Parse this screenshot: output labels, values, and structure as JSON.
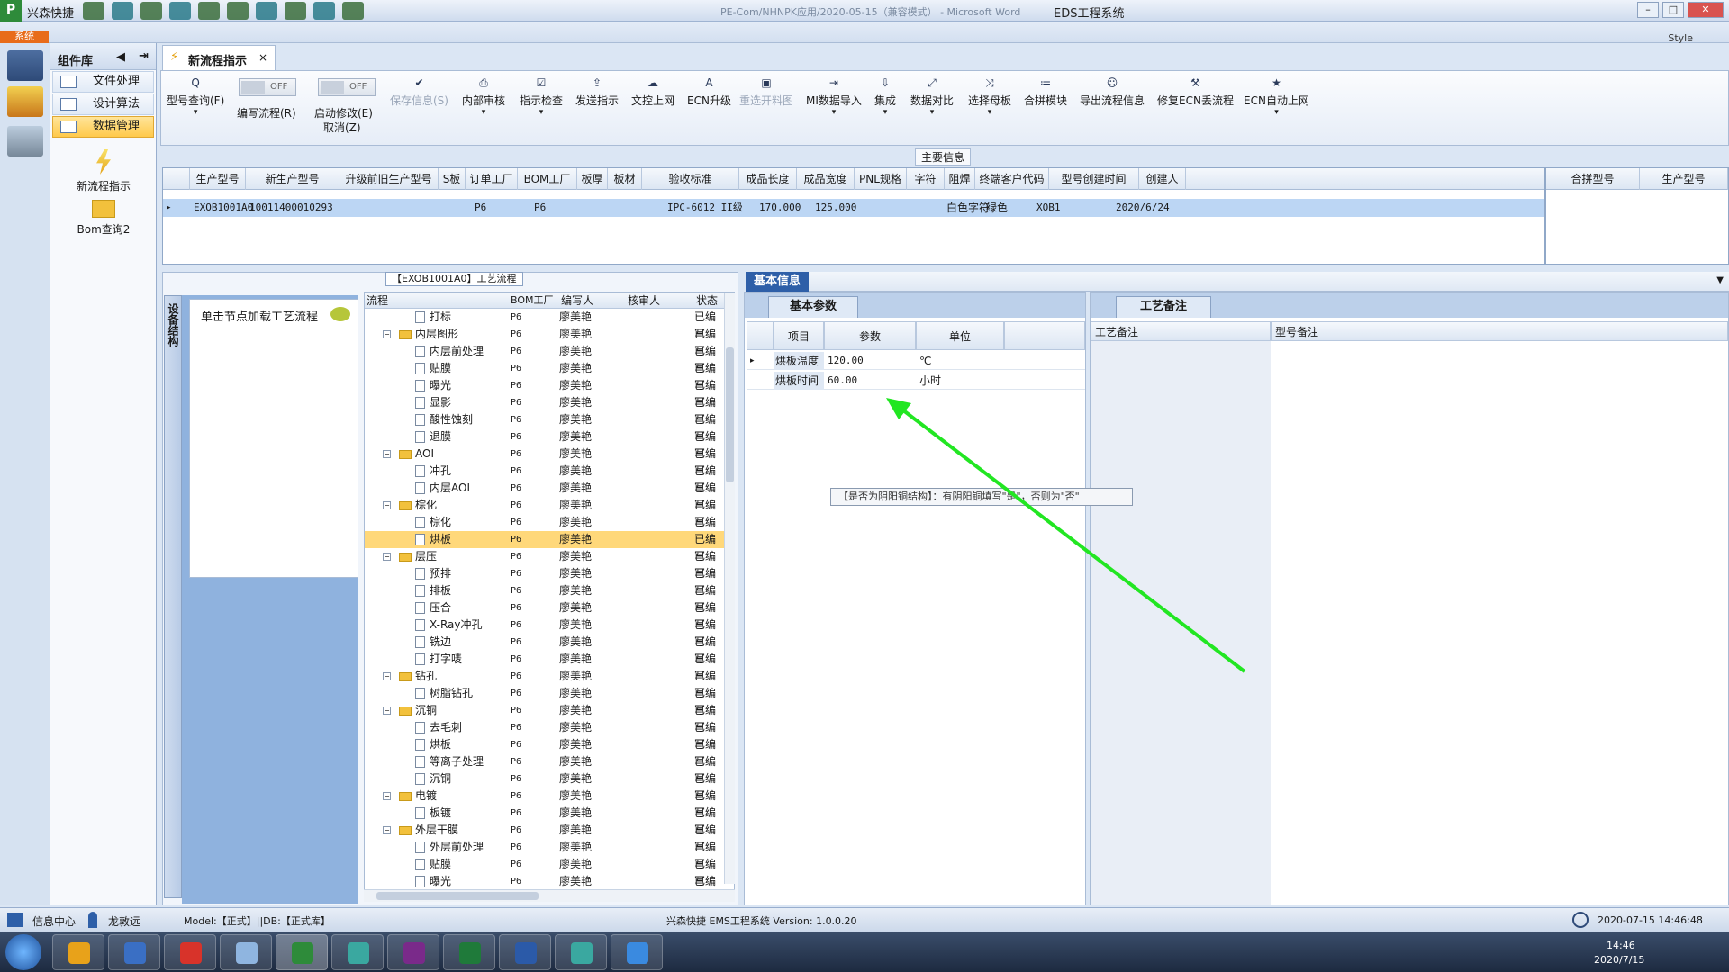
{
  "window": {
    "app_icon": "P",
    "quick_label": "兴森快捷",
    "title": "EDS工程系统",
    "doc_hint": "PE-Com/NHNPK应用/2020-05-15（兼容模式） - Microsoft Word"
  },
  "menu": {
    "system_tab": "系统",
    "style_label": "Style"
  },
  "modules": {
    "header": "组件库",
    "items": [
      {
        "label": "文件处理"
      },
      {
        "label": "设计算法"
      },
      {
        "label": "数据管理"
      }
    ],
    "big": [
      {
        "label": "新流程指示"
      },
      {
        "label": "Bom查询2"
      }
    ]
  },
  "doc_tab": {
    "label": "新流程指示",
    "close": "×"
  },
  "ribbon": {
    "items": [
      {
        "label": "型号查询(F)",
        "icon": "Q"
      },
      {
        "label": "编写流程(R)"
      },
      {
        "label": "启动修改(E)"
      },
      {
        "label": "取消(Z)"
      },
      {
        "label": "保存信息(S)",
        "icon": "✔"
      },
      {
        "label": "内部审核",
        "icon": "⎙"
      },
      {
        "label": "指示检查",
        "icon": "☑"
      },
      {
        "label": "发送指示",
        "icon": "⇪"
      },
      {
        "label": "文控上网",
        "icon": "☁"
      },
      {
        "label": "ECN升级",
        "icon": "A"
      },
      {
        "label": "重选开料图",
        "icon": "▣"
      },
      {
        "label": "MI数据导入",
        "icon": "⇥"
      },
      {
        "label": "集成",
        "icon": "⇩"
      },
      {
        "label": "数据对比",
        "icon": "⤢"
      },
      {
        "label": "选择母板",
        "icon": "⤨"
      },
      {
        "label": "合拼模块",
        "icon": "≔"
      },
      {
        "label": "导出流程信息",
        "icon": "☺"
      },
      {
        "label": "修复ECN丢流程",
        "icon": "⚒"
      },
      {
        "label": "ECN自动上网",
        "icon": "★"
      }
    ],
    "toggle_off": "OFF"
  },
  "main_info": {
    "title": "主要信息",
    "columns": [
      "生产型号",
      "新生产型号",
      "升级前旧生产型号",
      "S板",
      "订单工厂",
      "BOM工厂",
      "板厚",
      "板材",
      "验收标准",
      "成品长度",
      "成品宽度",
      "PNL规格",
      "字符",
      "阻焊",
      "终端客户代码",
      "型号创建时间",
      "创建人"
    ],
    "row": [
      "EXOB1001A0",
      "10011400010293",
      "",
      "",
      "P6",
      "P6",
      "",
      "",
      "IPC-6012 II级",
      "170.000",
      "125.000",
      "",
      "白色字符",
      "绿色",
      "XOB1",
      "2020/6/24",
      ""
    ],
    "side_columns": [
      "合拼型号",
      "生产型号"
    ]
  },
  "flow": {
    "title": "【EXOB1001A0】工艺流程",
    "side_tab": "设备结构",
    "hint": "单击节点加载工艺流程",
    "columns": [
      "流程",
      "BOM工厂",
      "编写人",
      "核审人",
      "状态"
    ],
    "rows": [
      {
        "level": 2,
        "name": "打标",
        "f": "P6",
        "w": "廖美艳",
        "s": "已编写"
      },
      {
        "level": 1,
        "name": "内层图形",
        "f": "P6",
        "w": "廖美艳",
        "s": "已编写"
      },
      {
        "level": 2,
        "name": "内层前处理",
        "f": "P6",
        "w": "廖美艳",
        "s": "已编写"
      },
      {
        "level": 2,
        "name": "贴膜",
        "f": "P6",
        "w": "廖美艳",
        "s": "已编写"
      },
      {
        "level": 2,
        "name": "曝光",
        "f": "P6",
        "w": "廖美艳",
        "s": "已编写"
      },
      {
        "level": 2,
        "name": "显影",
        "f": "P6",
        "w": "廖美艳",
        "s": "已编写"
      },
      {
        "level": 2,
        "name": "酸性蚀刻",
        "f": "P6",
        "w": "廖美艳",
        "s": "已编写"
      },
      {
        "level": 2,
        "name": "退膜",
        "f": "P6",
        "w": "廖美艳",
        "s": "已编写"
      },
      {
        "level": 1,
        "name": "AOI",
        "f": "P6",
        "w": "廖美艳",
        "s": "已编写"
      },
      {
        "level": 2,
        "name": "冲孔",
        "f": "P6",
        "w": "廖美艳",
        "s": "已编写"
      },
      {
        "level": 2,
        "name": "内层AOI",
        "f": "P6",
        "w": "廖美艳",
        "s": "已编写"
      },
      {
        "level": 1,
        "name": "棕化",
        "f": "P6",
        "w": "廖美艳",
        "s": "已编写"
      },
      {
        "level": 2,
        "name": "棕化",
        "f": "P6",
        "w": "廖美艳",
        "s": "已编写"
      },
      {
        "level": 2,
        "name": "烘板",
        "f": "P6",
        "w": "廖美艳",
        "s": "已编写",
        "sel": true
      },
      {
        "level": 1,
        "name": "层压",
        "f": "P6",
        "w": "廖美艳",
        "s": "已编写"
      },
      {
        "level": 2,
        "name": "预排",
        "f": "P6",
        "w": "廖美艳",
        "s": "已编写"
      },
      {
        "level": 2,
        "name": "排板",
        "f": "P6",
        "w": "廖美艳",
        "s": "已编写"
      },
      {
        "level": 2,
        "name": "压合",
        "f": "P6",
        "w": "廖美艳",
        "s": "已编写"
      },
      {
        "level": 2,
        "name": "X-Ray冲孔",
        "f": "P6",
        "w": "廖美艳",
        "s": "已编写"
      },
      {
        "level": 2,
        "name": "铣边",
        "f": "P6",
        "w": "廖美艳",
        "s": "已编写"
      },
      {
        "level": 2,
        "name": "打字唛",
        "f": "P6",
        "w": "廖美艳",
        "s": "已编写"
      },
      {
        "level": 1,
        "name": "钻孔",
        "f": "P6",
        "w": "廖美艳",
        "s": "已编写"
      },
      {
        "level": 2,
        "name": "树脂钻孔",
        "f": "P6",
        "w": "廖美艳",
        "s": "已编写"
      },
      {
        "level": 1,
        "name": "沉铜",
        "f": "P6",
        "w": "廖美艳",
        "s": "已编写"
      },
      {
        "level": 2,
        "name": "去毛刺",
        "f": "P6",
        "w": "廖美艳",
        "s": "已编写"
      },
      {
        "level": 2,
        "name": "烘板",
        "f": "P6",
        "w": "廖美艳",
        "s": "已编写"
      },
      {
        "level": 2,
        "name": "等离子处理",
        "f": "P6",
        "w": "廖美艳",
        "s": "已编写"
      },
      {
        "level": 2,
        "name": "沉铜",
        "f": "P6",
        "w": "廖美艳",
        "s": "已编写"
      },
      {
        "level": 1,
        "name": "电镀",
        "f": "P6",
        "w": "廖美艳",
        "s": "已编写"
      },
      {
        "level": 2,
        "name": "板镀",
        "f": "P6",
        "w": "廖美艳",
        "s": "已编写"
      },
      {
        "level": 1,
        "name": "外层干膜",
        "f": "P6",
        "w": "廖美艳",
        "s": "已编写"
      },
      {
        "level": 2,
        "name": "外层前处理",
        "f": "P6",
        "w": "廖美艳",
        "s": "已编写"
      },
      {
        "level": 2,
        "name": "贴膜",
        "f": "P6",
        "w": "廖美艳",
        "s": "已编写"
      },
      {
        "level": 2,
        "name": "曝光",
        "f": "P6",
        "w": "廖美艳",
        "s": "已编写"
      }
    ]
  },
  "basic": {
    "tab": "基本信息",
    "params_tab": "基本参数",
    "columns": [
      "项目",
      "参数",
      "单位"
    ],
    "rows": [
      [
        "烘板温度",
        "120.00",
        "℃"
      ],
      [
        "烘板时间",
        "60.00",
        "小时"
      ]
    ],
    "notes_tab": "工艺备注",
    "notes_columns": [
      "工艺备注",
      "型号备注"
    ],
    "tooltip": "【是否为阴阳铜结构】：有阴阳铜填写\"是\"，否则为\"否\""
  },
  "status": {
    "info_center": "信息中心",
    "user": "龙敦远",
    "model": "Model:【正式】||DB:【正式库】",
    "version": "兴森快捷 EMS工程系统 Version: 1.0.0.20",
    "datetime": "2020-07-15 14:46:48"
  },
  "taskbar": {
    "time": "14:46",
    "date": "2020/7/15"
  },
  "colors": {
    "annotation_arrow": "#22e622",
    "selection": "#ffd87a",
    "accent": "#2e5fa8"
  }
}
